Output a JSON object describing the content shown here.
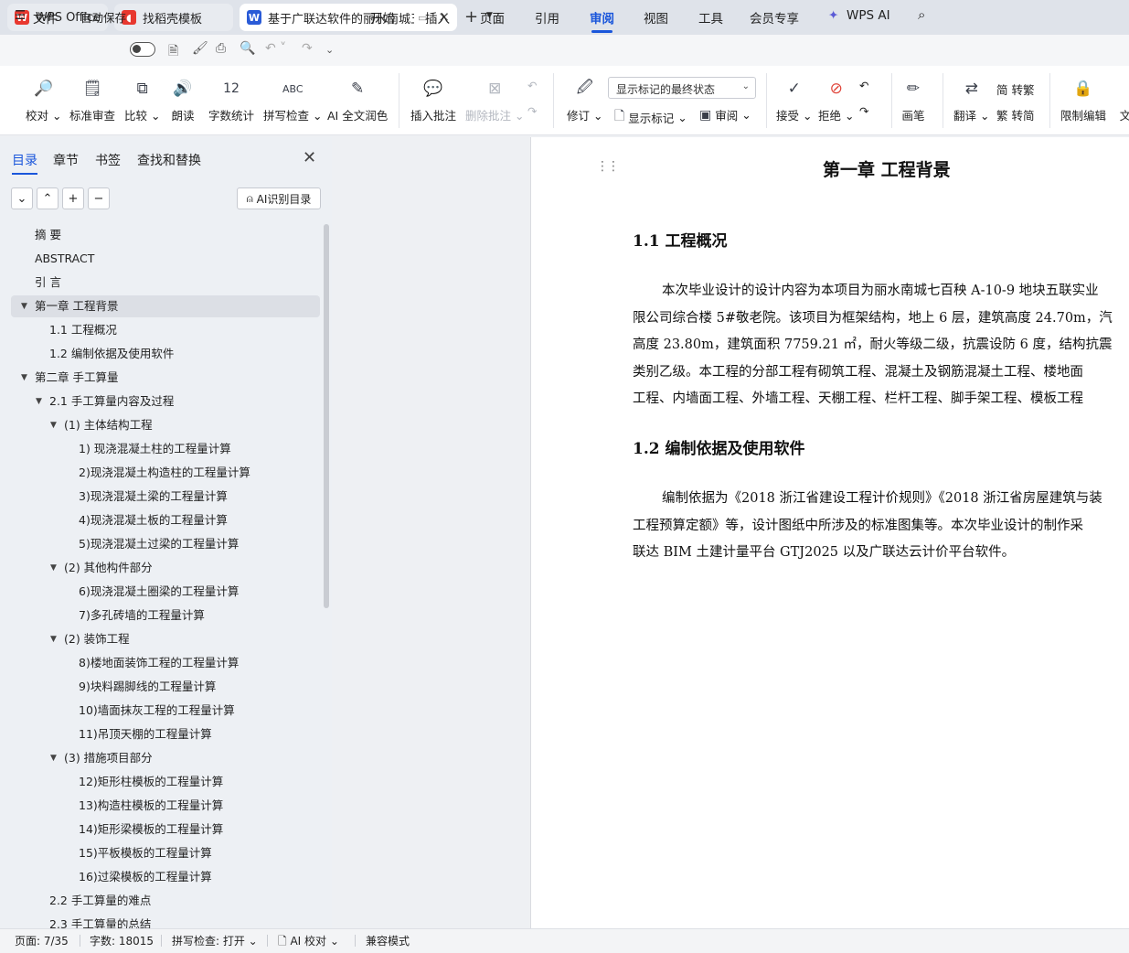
{
  "tabs": [
    {
      "label": "WPS Office",
      "color": "#e8382f"
    },
    {
      "label": "找稻壳模板",
      "color": "#e8382f"
    },
    {
      "label": "基于广联达软件的丽水南城五",
      "color": "#2a5bd7"
    }
  ],
  "menu": {
    "file": "文件",
    "autosave": "自动保存",
    "items": [
      "开始",
      "插入",
      "页面",
      "引用",
      "审阅",
      "视图",
      "工具",
      "会员专享"
    ],
    "active": "审阅",
    "wps_ai": "WPS AI"
  },
  "ribbon": {
    "proofread": "校对",
    "standard_review": "标准审查",
    "compare": "比较",
    "read_aloud": "朗读",
    "word_count": "字数统计",
    "spell_check": "拼写检查",
    "ai_polish": "AI 全文润色",
    "insert_comment": "插入批注",
    "delete_comment": "删除批注",
    "track_changes": "修订",
    "markup_mode": "显示标记的最终状态",
    "show_markup": "显示标记",
    "review": "审阅",
    "accept": "接受",
    "reject": "拒绝",
    "to_traditional": "简 转繁",
    "to_simplified": "繁 转简",
    "translate": "翻译",
    "pen": "画笔",
    "restrict_edit": "限制编辑",
    "doc_cut": "文"
  },
  "nav": {
    "tabs": [
      "目录",
      "章节",
      "书签",
      "查找和替换"
    ],
    "ai_toc": "AI识别目录",
    "toc": [
      {
        "label": "摘  要",
        "level": 0,
        "arrow": false
      },
      {
        "label": "ABSTRACT",
        "level": 0,
        "arrow": false
      },
      {
        "label": "引  言",
        "level": 0,
        "arrow": false
      },
      {
        "label": "第一章  工程背景",
        "level": 0,
        "arrow": true,
        "selected": true
      },
      {
        "label": "1.1  工程概况",
        "level": 1,
        "arrow": false
      },
      {
        "label": "1.2  编制依据及使用软件",
        "level": 1,
        "arrow": false
      },
      {
        "label": "第二章  手工算量",
        "level": 0,
        "arrow": true
      },
      {
        "label": "2.1  手工算量内容及过程",
        "level": 1,
        "arrow": true
      },
      {
        "label": "(1)  主体结构工程",
        "level": 2,
        "arrow": true
      },
      {
        "label": "1)  现浇混凝土柱的工程量计算",
        "level": 3,
        "arrow": false
      },
      {
        "label": "2)现浇混凝土构造柱的工程量计算",
        "level": 3,
        "arrow": false
      },
      {
        "label": "3)现浇混凝土梁的工程量计算",
        "level": 3,
        "arrow": false
      },
      {
        "label": "4)现浇混凝土板的工程量计算",
        "level": 3,
        "arrow": false
      },
      {
        "label": "5)现浇混凝土过梁的工程量计算",
        "level": 3,
        "arrow": false
      },
      {
        "label": "(2)  其他构件部分",
        "level": 2,
        "arrow": true
      },
      {
        "label": "6)现浇混凝土圈梁的工程量计算",
        "level": 3,
        "arrow": false
      },
      {
        "label": "7)多孔砖墙的工程量计算",
        "level": 3,
        "arrow": false
      },
      {
        "label": "(2)  装饰工程",
        "level": 2,
        "arrow": true
      },
      {
        "label": "8)楼地面装饰工程的工程量计算",
        "level": 3,
        "arrow": false
      },
      {
        "label": "9)块料踢脚线的工程量计算",
        "level": 3,
        "arrow": false
      },
      {
        "label": "10)墙面抹灰工程的工程量计算",
        "level": 3,
        "arrow": false
      },
      {
        "label": "11)吊顶天棚的工程量计算",
        "level": 3,
        "arrow": false
      },
      {
        "label": "(3)  措施项目部分",
        "level": 2,
        "arrow": true
      },
      {
        "label": "12)矩形柱模板的工程量计算",
        "level": 3,
        "arrow": false
      },
      {
        "label": "13)构造柱模板的工程量计算",
        "level": 3,
        "arrow": false
      },
      {
        "label": "14)矩形梁模板的工程量计算",
        "level": 3,
        "arrow": false
      },
      {
        "label": "15)平板模板的工程量计算",
        "level": 3,
        "arrow": false
      },
      {
        "label": "16)过梁模板的工程量计算",
        "level": 3,
        "arrow": false
      },
      {
        "label": "2.2  手工算量的难点",
        "level": 1,
        "arrow": false
      },
      {
        "label": "2.3  手工算量的总结",
        "level": 1,
        "arrow": false
      }
    ]
  },
  "doc": {
    "chapter_title": "第一章  工程背景",
    "sec1_title": "1.1  工程概况",
    "sec1_lines": [
      "本次毕业设计的设计内容为本项目为丽水南城七百秧 A-10-9 地块五联实业",
      "限公司综合楼 5#敬老院。该项目为框架结构，地上 6 层，建筑高度 24.70m，汽",
      "高度 23.80m，建筑面积 7759.21 ㎡，耐火等级二级，抗震设防 6 度，结构抗震",
      "类别乙级。本工程的分部工程有砌筑工程、混凝土及钢筋混凝土工程、楼地面",
      "工程、内墙面工程、外墙工程、天棚工程、栏杆工程、脚手架工程、模板工程"
    ],
    "sec2_title": "1.2  编制依据及使用软件",
    "sec2_lines": [
      "编制依据为《2018 浙江省建设工程计价规则》《2018 浙江省房屋建筑与装",
      "工程预算定额》等，设计图纸中所涉及的标准图集等。本次毕业设计的制作采",
      "联达 BIM 土建计量平台 GTJ2025 以及广联达云计价平台软件。"
    ]
  },
  "status": {
    "page": "页面: 7/35",
    "words": "字数: 18015",
    "spell": "拼写检查: 打开",
    "ai_proof": "AI 校对",
    "compat": "兼容模式"
  },
  "colors": {
    "accent": "#1a56db"
  }
}
